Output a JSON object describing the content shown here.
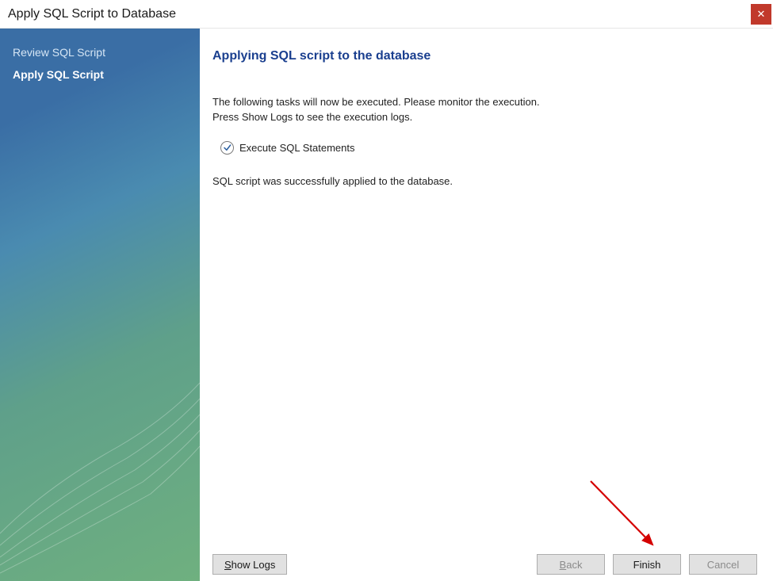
{
  "window": {
    "title": "Apply SQL Script to Database"
  },
  "sidebar": {
    "items": [
      {
        "label": "Review SQL Script",
        "active": false
      },
      {
        "label": "Apply SQL Script",
        "active": true
      }
    ]
  },
  "main": {
    "heading": "Applying SQL script to the database",
    "line1": "The following tasks will now be executed. Please monitor the execution.",
    "line2": "Press Show Logs to see the execution logs.",
    "tasks": [
      {
        "label": "Execute SQL Statements",
        "done": true
      }
    ],
    "success": "SQL script was successfully applied to the database."
  },
  "buttons": {
    "show_logs": "Show Logs",
    "back": "Back",
    "finish": "Finish",
    "cancel": "Cancel"
  }
}
